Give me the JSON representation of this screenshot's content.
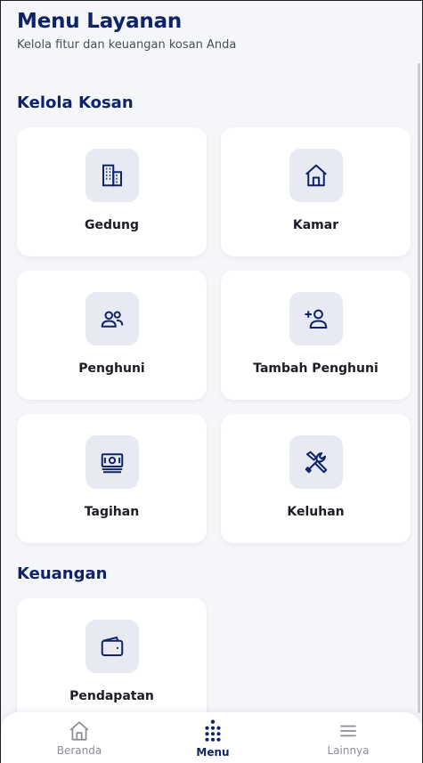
{
  "header": {
    "title": "Menu Layanan",
    "subtitle": "Kelola fitur dan keuangan kosan Anda"
  },
  "sections": [
    {
      "title": "Kelola Kosan",
      "items": [
        {
          "label": "Gedung",
          "icon": "building-icon"
        },
        {
          "label": "Kamar",
          "icon": "home-icon"
        },
        {
          "label": "Penghuni",
          "icon": "users-icon"
        },
        {
          "label": "Tambah Penghuni",
          "icon": "user-plus-icon"
        },
        {
          "label": "Tagihan",
          "icon": "banknote-icon"
        },
        {
          "label": "Keluhan",
          "icon": "tools-icon"
        }
      ]
    },
    {
      "title": "Keuangan",
      "items": [
        {
          "label": "Pendapatan",
          "icon": "wallet-icon"
        }
      ]
    }
  ],
  "bottom_nav": [
    {
      "label": "Beranda",
      "icon": "home-icon",
      "active": false
    },
    {
      "label": "Menu",
      "icon": "dot-grid-icon",
      "active": true
    },
    {
      "label": "Lainnya",
      "icon": "hamburger-icon",
      "active": false
    }
  ],
  "colors": {
    "primary": "#0f2468",
    "background": "#f5f6fa",
    "icon_box": "#e7eaf2",
    "card": "#ffffff"
  }
}
